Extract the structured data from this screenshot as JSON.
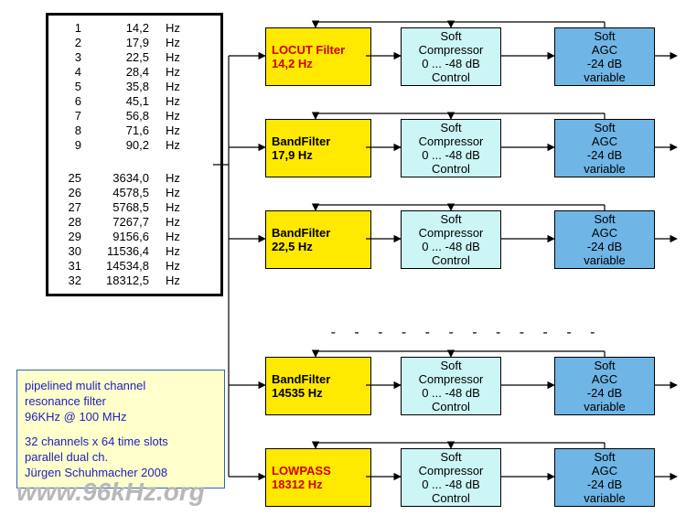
{
  "freq_table": {
    "rows_top": [
      {
        "n": "1",
        "v": "14,2",
        "u": "Hz"
      },
      {
        "n": "2",
        "v": "17,9",
        "u": "Hz"
      },
      {
        "n": "3",
        "v": "22,5",
        "u": "Hz"
      },
      {
        "n": "4",
        "v": "28,4",
        "u": "Hz"
      },
      {
        "n": "5",
        "v": "35,8",
        "u": "Hz"
      },
      {
        "n": "6",
        "v": "45,1",
        "u": "Hz"
      },
      {
        "n": "7",
        "v": "56,8",
        "u": "Hz"
      },
      {
        "n": "8",
        "v": "71,6",
        "u": "Hz"
      },
      {
        "n": "9",
        "v": "90,2",
        "u": "Hz"
      }
    ],
    "rows_bot": [
      {
        "n": "25",
        "v": "3634,0",
        "u": "Hz"
      },
      {
        "n": "26",
        "v": "4578,5",
        "u": "Hz"
      },
      {
        "n": "27",
        "v": "5768,5",
        "u": "Hz"
      },
      {
        "n": "28",
        "v": "7267,7",
        "u": "Hz"
      },
      {
        "n": "29",
        "v": "9156,6",
        "u": "Hz"
      },
      {
        "n": "30",
        "v": "11536,4",
        "u": "Hz"
      },
      {
        "n": "31",
        "v": "14534,8",
        "u": "Hz"
      },
      {
        "n": "32",
        "v": "18312,5",
        "u": "Hz"
      }
    ]
  },
  "info": {
    "l1": "pipelined mulit channel",
    "l2": "resonance  filter",
    "l3": "96KHz @ 100 MHz",
    "l4": "32 channels x 64 time slots",
    "l5": "parallel dual ch.",
    "l6": "Jürgen Schuhmacher 2008"
  },
  "watermark": "www.96kHz.org",
  "rows": [
    {
      "filter_l1": "LOCUT Filter",
      "filter_l2": "14,2 Hz",
      "red": true
    },
    {
      "filter_l1": "BandFilter",
      "filter_l2": "17,9 Hz",
      "red": false
    },
    {
      "filter_l1": "BandFilter",
      "filter_l2": "22,5 Hz",
      "red": false
    },
    {
      "filter_l1": "BandFilter",
      "filter_l2": "14535 Hz",
      "red": false
    },
    {
      "filter_l1": "LOWPASS",
      "filter_l2": "18312 Hz",
      "red": true
    }
  ],
  "comp": {
    "l1": "Soft",
    "l2": "Compressor",
    "l3": "0 ... -48 dB",
    "l4": "Control"
  },
  "agc": {
    "l1": "Soft",
    "l2": "AGC",
    "l3": "-24 dB",
    "l4": "variable"
  },
  "dashes": "-  -  -  -  -  -  -  -  -  -  -  -"
}
